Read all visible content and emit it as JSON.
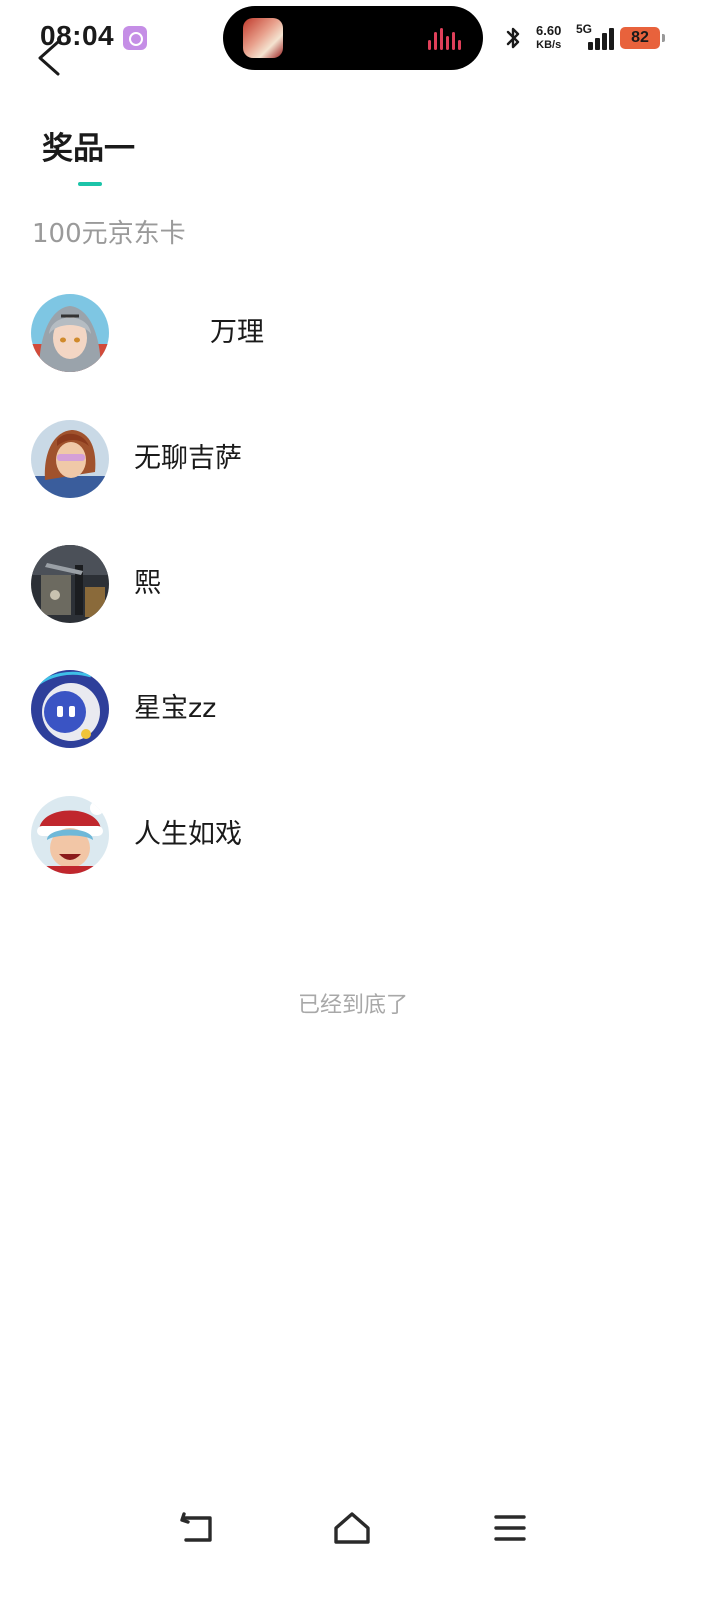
{
  "status_bar": {
    "time": "08:04",
    "net_speed_value": "6.60",
    "net_speed_unit": "KB/s",
    "network_type": "5G",
    "battery_level": "82",
    "icons": [
      "app-notification-icon",
      "bluetooth-icon",
      "signal-icon",
      "battery-icon"
    ]
  },
  "header": {
    "back_icon": "chevron-left-icon"
  },
  "tab": {
    "label": "奖品一",
    "indicator_color": "#1cc4a9"
  },
  "prize": {
    "name": "100元京东卡"
  },
  "winners": [
    {
      "name": "万理",
      "avatar": "avatar-silver-hair"
    },
    {
      "name": "无聊吉萨",
      "avatar": "avatar-brown-hair"
    },
    {
      "name": "熙",
      "avatar": "avatar-dark-scene"
    },
    {
      "name": "星宝zz",
      "avatar": "avatar-robot"
    },
    {
      "name": "人生如戏",
      "avatar": "avatar-santa-hat"
    }
  ],
  "footer": {
    "end_text": "已经到底了"
  },
  "nav_bar": {
    "icons": [
      "back-nav-icon",
      "home-nav-icon",
      "menu-nav-icon"
    ]
  },
  "colors": {
    "accent": "#1cc4a9",
    "text_primary": "#1a1a1a",
    "text_secondary": "#9a9a9a",
    "battery": "#e8623c"
  }
}
